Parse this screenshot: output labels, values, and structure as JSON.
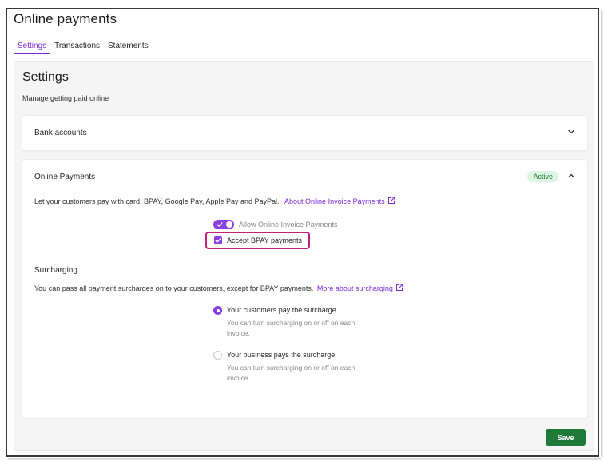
{
  "page": {
    "title": "Online payments"
  },
  "tabs": [
    {
      "label": "Settings",
      "active": true
    },
    {
      "label": "Transactions",
      "active": false
    },
    {
      "label": "Statements",
      "active": false
    }
  ],
  "settings": {
    "title": "Settings",
    "subtitle": "Manage getting paid online"
  },
  "bank_accounts": {
    "title": "Bank accounts"
  },
  "online_payments": {
    "title": "Online Payments",
    "status_badge": "Active",
    "description": "Let your customers pay with card, BPAY, Google Pay, Apple Pay and PayPal.",
    "about_link": "About Online Invoice Payments",
    "allow_toggle_label": "Allow Online Invoice Payments",
    "allow_toggle_on": true,
    "bpay_checkbox_label": "Accept BPAY payments",
    "bpay_checked": true
  },
  "surcharging": {
    "title": "Surcharging",
    "description": "You can pass all payment surcharges on to your customers, except for BPAY payments.",
    "more_link": "More about surcharging",
    "options": [
      {
        "label": "Your customers pay the surcharge",
        "help": "You can turn surcharging on or off on each invoice.",
        "selected": true
      },
      {
        "label": "Your business pays the surcharge",
        "help": "You can turn surcharging on or off on each invoice.",
        "selected": false
      }
    ]
  },
  "actions": {
    "save_label": "Save"
  },
  "colors": {
    "accent": "#7b2bd6",
    "save_green": "#1f7a3a",
    "active_badge_bg": "#dcf5e4",
    "highlight_border": "#c2217a"
  },
  "icons": {
    "chevron_down": "chevron-down-icon",
    "chevron_up": "chevron-up-icon",
    "external_link": "external-link-icon"
  }
}
